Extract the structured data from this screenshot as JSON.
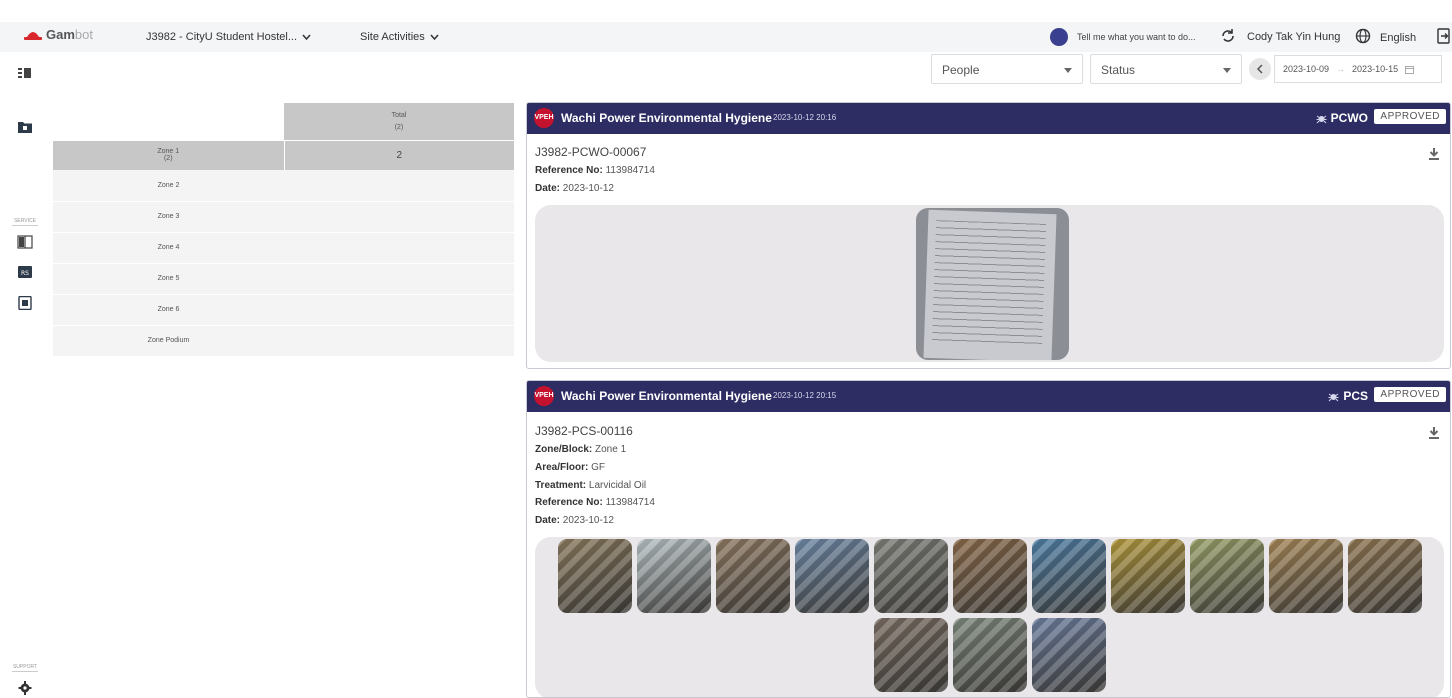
{
  "header": {
    "logo_text": "Gam",
    "logo_text_suffix": "bot",
    "project": "J3982 - CityU Student Hostel...",
    "nav_item": "Site Activities",
    "assistant_placeholder": "Tell me what you want to do...",
    "user_name": "Cody Tak Yin Hung",
    "language": "English"
  },
  "sidebar": {
    "section_label_1": "SERVICE",
    "section_label_2": "SUPPORT"
  },
  "filters": {
    "people_placeholder": "People",
    "status_placeholder": "Status",
    "date_start": "2023-10-09",
    "date_separator": "→",
    "date_end": "2023-10-15"
  },
  "zone_table": {
    "total_header": "Total",
    "total_count": "(2)",
    "rows": [
      {
        "name": "Zone 1",
        "count": "(2)",
        "total": "2"
      },
      {
        "name": "Zone 2",
        "count": "",
        "total": ""
      },
      {
        "name": "Zone 3",
        "count": "",
        "total": ""
      },
      {
        "name": "Zone 4",
        "count": "",
        "total": ""
      },
      {
        "name": "Zone 5",
        "count": "",
        "total": ""
      },
      {
        "name": "Zone 6",
        "count": "",
        "total": ""
      },
      {
        "name": "Zone Podium",
        "count": "",
        "total": ""
      }
    ]
  },
  "cards": [
    {
      "badge": "VPEH",
      "company": "Wachi Power Environmental Hygiene",
      "timestamp": "2023-10-12 20:16",
      "doc_type": "PCWO",
      "status": "APPROVED",
      "code": "J3982-PCWO-00067",
      "ref_label": "Reference No:",
      "ref_value": "113984714",
      "date_label": "Date:",
      "date_value": "2023-10-12"
    },
    {
      "badge": "VPEH",
      "company": "Wachi Power Environmental Hygiene",
      "timestamp": "2023-10-12 20:15",
      "doc_type": "PCS",
      "status": "APPROVED",
      "code": "J3982-PCS-00116",
      "zone_label": "Zone/Block:",
      "zone_value": "Zone 1",
      "area_label": "Area/Floor:",
      "area_value": "GF",
      "treatment_label": "Treatment:",
      "treatment_value": "Larvicidal Oil",
      "ref_label": "Reference No:",
      "ref_value": "113984714",
      "date_label": "Date:",
      "date_value": "2023-10-12"
    }
  ],
  "colors": {
    "card_header": "#2d2c63",
    "badge_red": "#c4122f",
    "selected_row": "#c7c7c7",
    "page_bg": "#ffffff"
  },
  "photo_tints": [
    "#8a7a5e",
    "#b9c4c8",
    "#8f7a63",
    "#6f8aa8",
    "#7e8079",
    "#8a6a4a",
    "#4f7fa6",
    "#b49a3e",
    "#9aa26a",
    "#a68758",
    "#8f7652",
    "#7a6e63",
    "#7f8a7e",
    "#6d7fa0"
  ]
}
